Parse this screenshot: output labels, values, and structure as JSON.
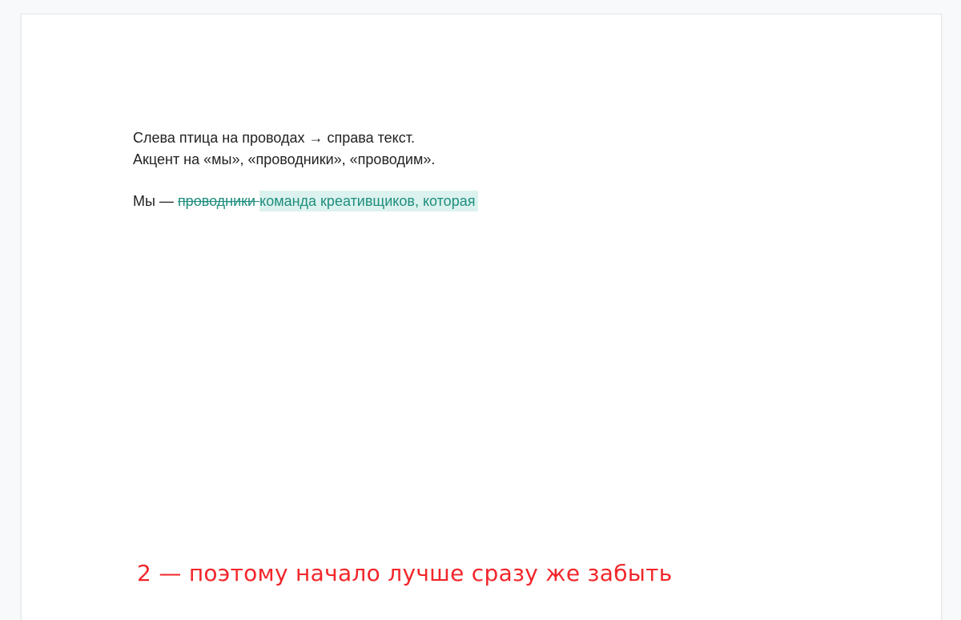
{
  "document": {
    "lines": [
      "Слева птица на проводах → справа текст.",
      "Акцент на «мы», «проводники», «проводим»."
    ],
    "edit_line": {
      "prefix": "Мы — ",
      "deleted": "проводники ",
      "inserted": "команда креативщиков, которая"
    }
  },
  "caption": "2 — поэтому начало лучше сразу же забыть",
  "colors": {
    "suggestion_text": "#1e8e7e",
    "suggestion_highlight": "#dcf2ee",
    "caption": "#f2262a",
    "body_text": "#222222"
  }
}
